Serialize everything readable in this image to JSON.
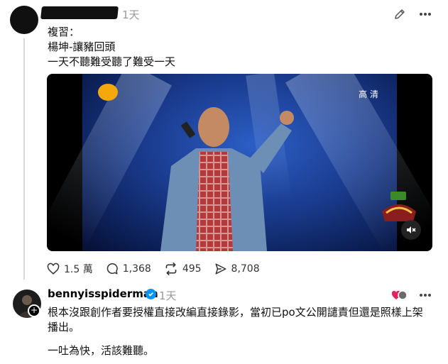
{
  "post1": {
    "time": "1天",
    "lines": [
      "複習：",
      "楊坤-讓豬回頭",
      "一天不聽難受聽了難受一天"
    ],
    "video": {
      "quality_label": "高 清"
    },
    "stats": {
      "likes": "1.5 萬",
      "comments": "1,368",
      "reposts": "495",
      "shares": "8,708"
    }
  },
  "reply": {
    "username": "bennyisspiderman",
    "time": "1天",
    "text_line1": "根本沒跟創作者要授權直接改編直接錄影，當初已po文公開譴責但還是照樣上架",
    "text_line2": "播出。",
    "text_line3": "一吐為快，活該難聽。"
  },
  "icons": {
    "edit": "pencil-icon",
    "more": "more-horizontal-icon",
    "like": "heart-icon",
    "comment": "comment-bubble-icon",
    "repost": "repost-icon",
    "share": "send-icon",
    "mute": "muted-speaker-icon",
    "verified": "verified-badge-icon"
  },
  "colors": {
    "verified": "#0095f6",
    "muted_text": "#999999",
    "heart": "#e0245e"
  }
}
